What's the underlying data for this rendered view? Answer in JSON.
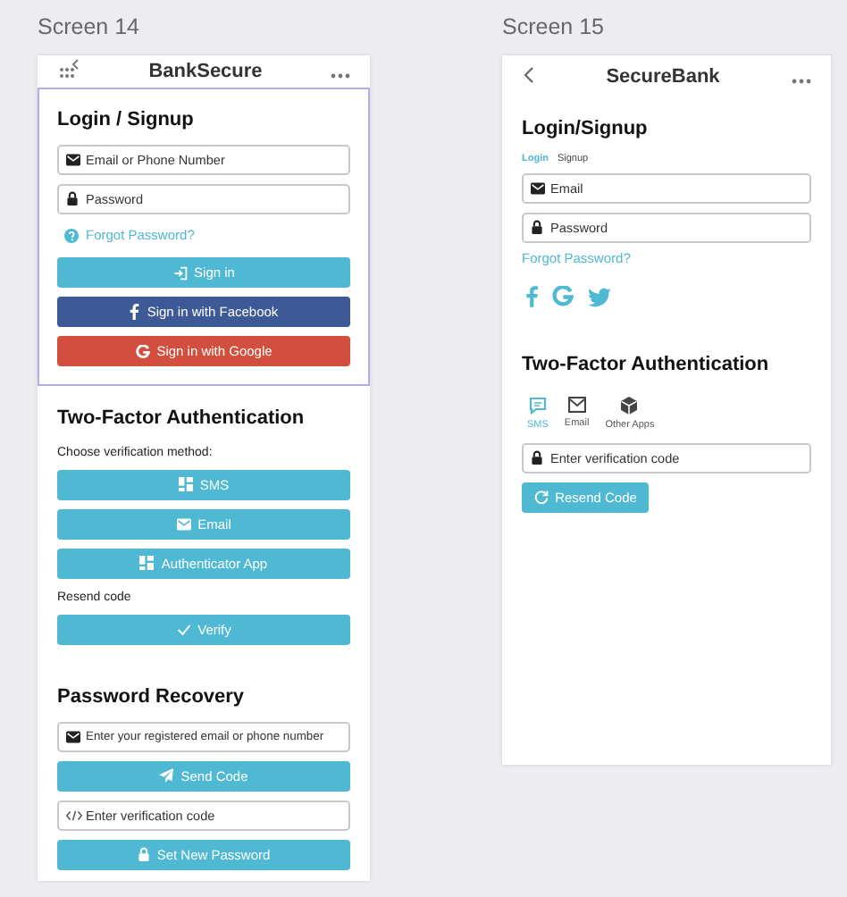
{
  "screen_14": {
    "caption": "Screen 14",
    "header": {
      "title": "BankSecure"
    },
    "login": {
      "selected": true,
      "heading": "Login / Signup",
      "email_field": {
        "placeholder": "Email or Phone Number"
      },
      "password_field": {
        "placeholder": "Password"
      },
      "forgot_link": "Forgot Password?",
      "sign_in_button": "Sign in",
      "facebook_button": "Sign in with Facebook",
      "google_button": "Sign in with Google"
    },
    "two_factor": {
      "heading": "Two-Factor Authentication",
      "prompt": "Choose verification method:",
      "sms_button": "SMS",
      "email_button": "Email",
      "app_button": "Authenticator App",
      "resend_label": "Resend code",
      "verify_button": "Verify"
    },
    "recovery": {
      "heading": "Password Recovery",
      "contact_field": {
        "placeholder": "Enter your registered email or phone number"
      },
      "send_button": "Send Code",
      "code_field": {
        "placeholder": "Enter verification code"
      },
      "set_password_button": "Set New Password"
    }
  },
  "screen_15": {
    "caption": "Screen 15",
    "header": {
      "title": "SecureBank"
    },
    "login": {
      "heading": "Login/Signup",
      "tabs": [
        {
          "label": "Login",
          "selected": true
        },
        {
          "label": "Signup",
          "selected": false
        }
      ],
      "email_field": {
        "placeholder": "Email"
      },
      "password_field": {
        "placeholder": "Password"
      },
      "forgot_link": "Forgot Password?"
    },
    "two_factor": {
      "heading": "Two-Factor Authentication",
      "methods": [
        {
          "label": "SMS",
          "selected": true
        },
        {
          "label": "Email",
          "selected": false
        },
        {
          "label": "Other Apps",
          "selected": false
        }
      ],
      "code_field": {
        "placeholder": "Enter verification code"
      },
      "resend_button": "Resend Code"
    }
  }
}
